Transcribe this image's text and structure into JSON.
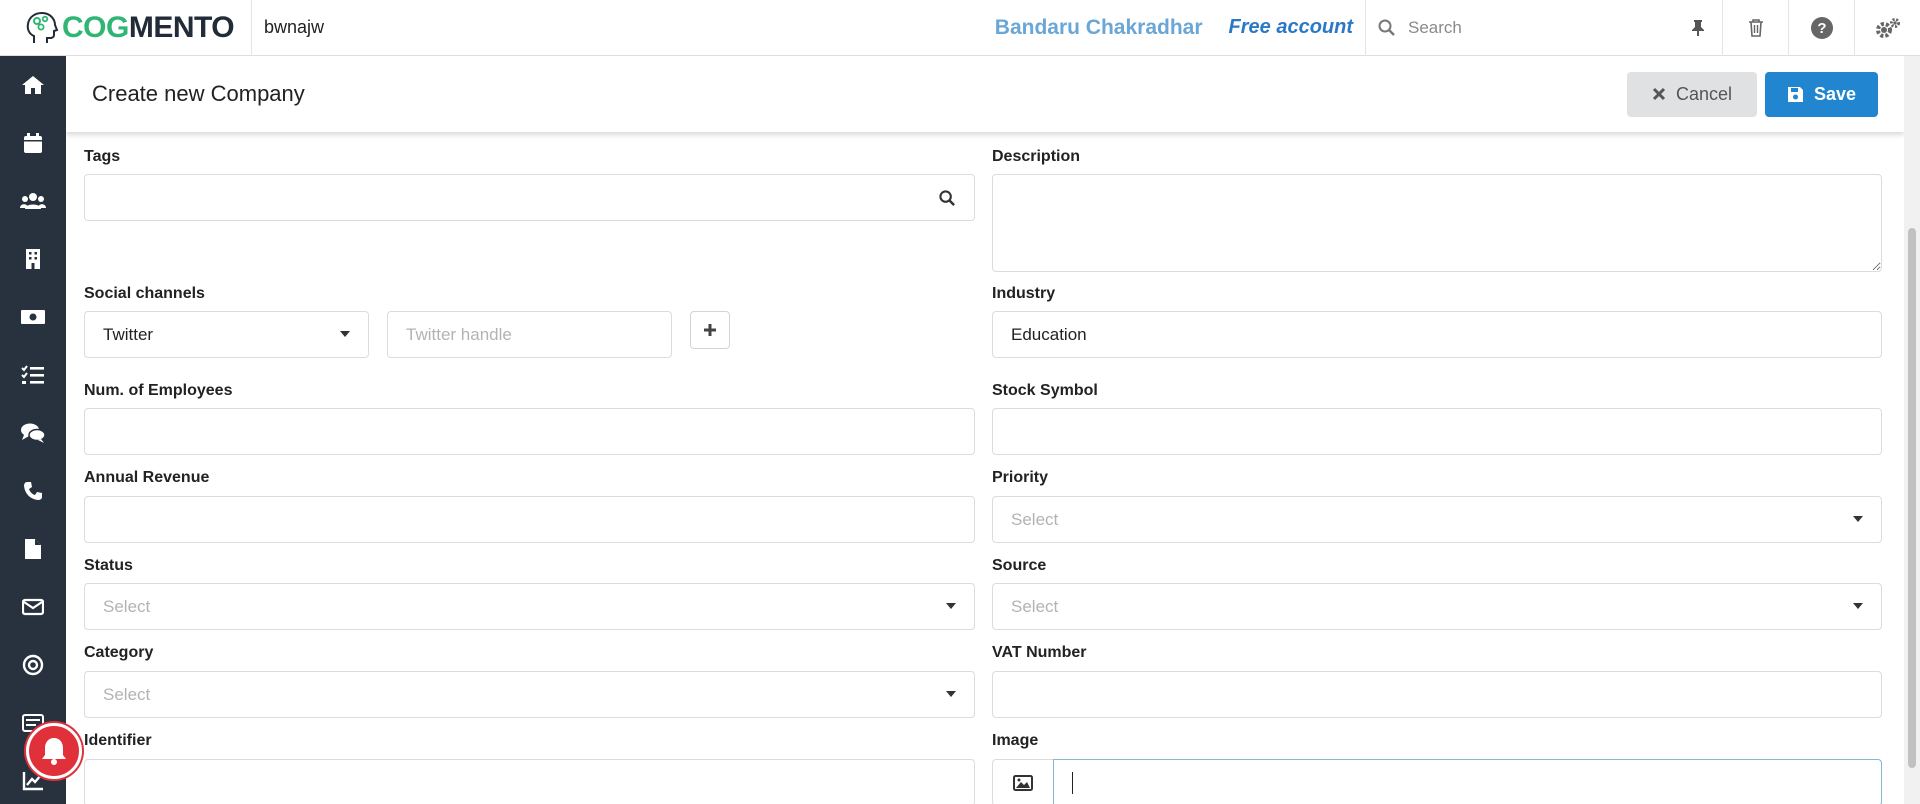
{
  "topbar": {
    "logo_part1": "COG",
    "logo_part2": "MENTO",
    "workspace": "bwnajw",
    "user_name": "Bandaru Chakradhar",
    "account_type": "Free account",
    "search_placeholder": "Search"
  },
  "sidebar": {
    "icons": [
      "home-icon",
      "calendar-icon",
      "contacts-icon",
      "companies-icon",
      "deals-icon",
      "tasks-icon",
      "cases-icon",
      "calls-icon",
      "documents-icon",
      "email-icon",
      "campaigns-icon",
      "forms-icon",
      "reports-icon"
    ]
  },
  "header": {
    "title": "Create new Company",
    "cancel_label": "Cancel",
    "save_label": "Save"
  },
  "form": {
    "tags_label": "Tags",
    "description_label": "Description",
    "social_label": "Social channels",
    "social_channel_value": "Twitter",
    "social_handle_placeholder": "Twitter handle",
    "industry_label": "Industry",
    "industry_value": "Education",
    "employees_label": "Num. of Employees",
    "stock_label": "Stock Symbol",
    "revenue_label": "Annual Revenue",
    "priority_label": "Priority",
    "priority_placeholder": "Select",
    "status_label": "Status",
    "status_placeholder": "Select",
    "source_label": "Source",
    "source_placeholder": "Select",
    "category_label": "Category",
    "category_placeholder": "Select",
    "vat_label": "VAT Number",
    "identifier_label": "Identifier",
    "image_label": "Image"
  },
  "colors": {
    "sidebar_bg": "#27323e",
    "save_button": "#2185d0",
    "cancel_button": "#e0e1e2",
    "logo_green": "#2fb574",
    "notification_red": "#e0313b"
  }
}
